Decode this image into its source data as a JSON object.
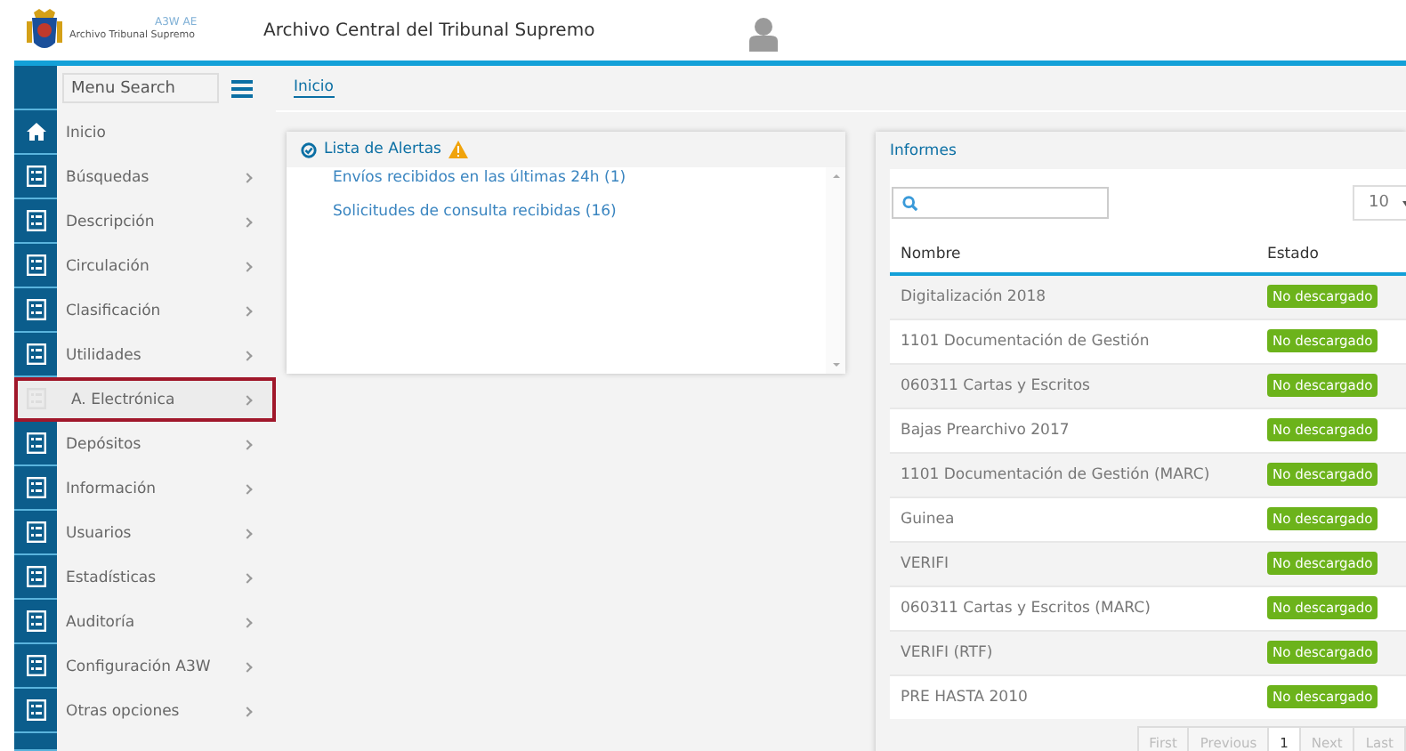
{
  "header": {
    "app_code": "A3W AE",
    "logo_caption": "Archivo Tribunal Supremo",
    "title": "Archivo Central del Tribunal Supremo"
  },
  "sidebar": {
    "search": {
      "placeholder": "Menu Search"
    },
    "items": [
      {
        "label": "Inicio",
        "kind": "home",
        "has_submenu": false,
        "selected": false
      },
      {
        "label": "Búsquedas",
        "kind": "list",
        "has_submenu": true,
        "selected": false
      },
      {
        "label": "Descripción",
        "kind": "list",
        "has_submenu": true,
        "selected": false
      },
      {
        "label": "Circulación",
        "kind": "list",
        "has_submenu": true,
        "selected": false
      },
      {
        "label": "Clasificación",
        "kind": "list",
        "has_submenu": true,
        "selected": false
      },
      {
        "label": "Utilidades",
        "kind": "list",
        "has_submenu": true,
        "selected": false
      },
      {
        "label": "A. Electrónica",
        "kind": "list",
        "has_submenu": true,
        "selected": true
      },
      {
        "label": "Depósitos",
        "kind": "list",
        "has_submenu": true,
        "selected": false
      },
      {
        "label": "Información",
        "kind": "list",
        "has_submenu": true,
        "selected": false
      },
      {
        "label": "Usuarios",
        "kind": "list",
        "has_submenu": true,
        "selected": false
      },
      {
        "label": "Estadísticas",
        "kind": "list",
        "has_submenu": true,
        "selected": false
      },
      {
        "label": "Auditoría",
        "kind": "list",
        "has_submenu": true,
        "selected": false
      },
      {
        "label": "Configuración A3W",
        "kind": "list",
        "has_submenu": true,
        "selected": false
      },
      {
        "label": "Otras opciones",
        "kind": "list",
        "has_submenu": true,
        "selected": false
      }
    ]
  },
  "breadcrumb": "Inicio",
  "alerts": {
    "title": "Lista de Alertas",
    "items": [
      "Envíos recibidos en las últimas 24h (1)",
      "Solicitudes de consulta recibidas (16)"
    ]
  },
  "reports": {
    "title": "Informes",
    "page_size": "10",
    "table": {
      "columns": [
        "Nombre",
        "Estado"
      ],
      "rows": [
        {
          "name": "Digitalización 2018",
          "status": "No descargado"
        },
        {
          "name": "1101 Documentación de Gestión",
          "status": "No descargado"
        },
        {
          "name": "060311 Cartas y Escritos",
          "status": "No descargado"
        },
        {
          "name": "Bajas Prearchivo 2017",
          "status": "No descargado"
        },
        {
          "name": "1101 Documentación de Gestión (MARC)",
          "status": "No descargado"
        },
        {
          "name": "Guinea",
          "status": "No descargado"
        },
        {
          "name": "VERIFI",
          "status": "No descargado"
        },
        {
          "name": "060311 Cartas y Escritos (MARC)",
          "status": "No descargado"
        },
        {
          "name": "VERIFI (RTF)",
          "status": "No descargado"
        },
        {
          "name": "PRE HASTA 2010",
          "status": "No descargado"
        }
      ]
    },
    "pagination": [
      {
        "label": "First",
        "selected": false
      },
      {
        "label": "Previous",
        "selected": false
      },
      {
        "label": "1",
        "selected": true
      },
      {
        "label": "Next",
        "selected": false
      },
      {
        "label": "Last",
        "selected": false
      }
    ]
  }
}
